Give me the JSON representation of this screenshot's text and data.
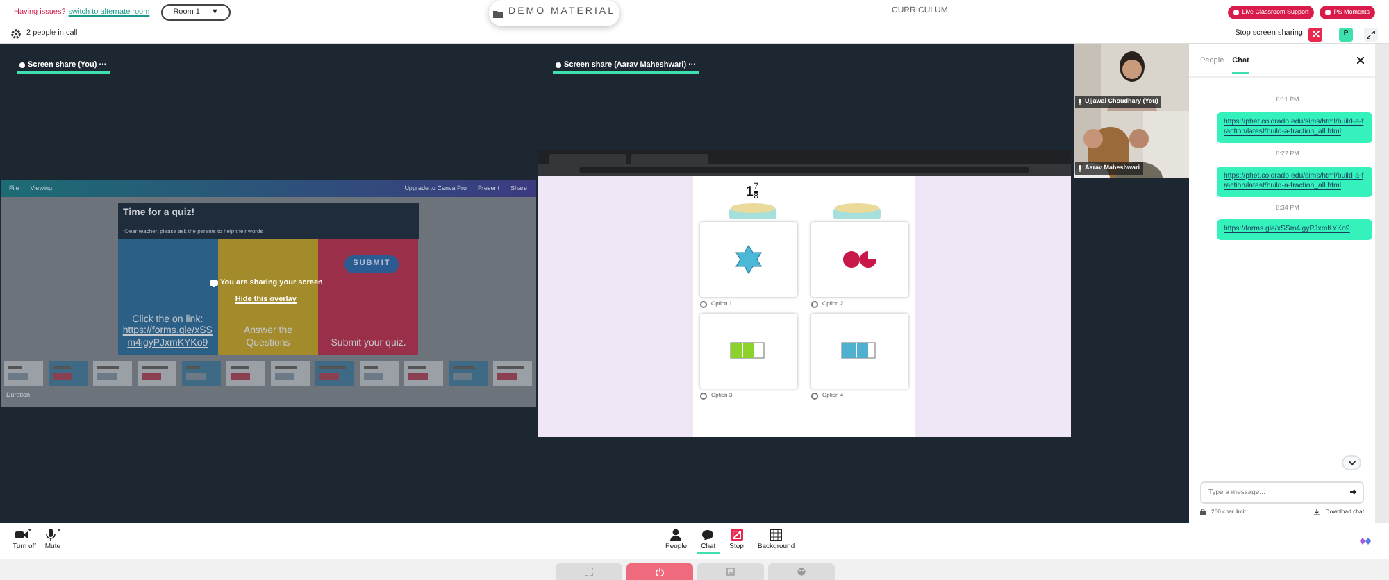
{
  "top_bar": {
    "issue_text": "Having issues?",
    "switch_link": "switch to alternate room",
    "room": "Room 1",
    "room_caret": "▼",
    "center_button": "DEMO MATERIAL",
    "curriculum": "CURRICULUM",
    "buttons": [
      "Live Classroom Support",
      "PS Moments"
    ]
  },
  "call_bar": {
    "people_count": "2 people in call",
    "stop_sharing": "Stop screen sharing",
    "avatar_letter": "P"
  },
  "screens": [
    {
      "title": "Screen share (You)",
      "menu": "···",
      "kind": "canva",
      "toolbar": [
        "File",
        "Viewing",
        "Upgrade to Canva Pro",
        "Present",
        "Share"
      ],
      "slide": {
        "title": "Time for a quiz!",
        "note": "*Dear teacher, please ask the parents to help their words",
        "columns": [
          {
            "text": "Click the on link:",
            "link": "https://forms.gle/xSSm4igyPJxmKYKo9",
            "color": "#2b5f86"
          },
          {
            "text": "Answer the Questions",
            "color": "#a38a2a"
          },
          {
            "text": "Submit your quiz.",
            "button": "SUBMIT",
            "color": "#9a2f4a"
          }
        ]
      },
      "footer": "Duration",
      "overlay": {
        "message": "You are sharing your screen",
        "hide_link": "Hide this overlay"
      }
    },
    {
      "title": "Screen share (Aarav Maheshwari)",
      "menu": "···",
      "kind": "browser",
      "fraction": {
        "whole": "1",
        "numerator": "7",
        "denominator": "8"
      },
      "options": [
        {
          "label": "Option 1",
          "kind": "star",
          "selected": false
        },
        {
          "label": "Option 2",
          "kind": "circles",
          "selected": false
        },
        {
          "label": "Option 3",
          "kind": "green-bars",
          "selected": false
        },
        {
          "label": "Option 4",
          "kind": "blue-bars",
          "selected": false
        }
      ]
    }
  ],
  "videos": [
    {
      "name": "Ujjawal Choudhary (You)",
      "kind": "single"
    },
    {
      "name": "Aarav Maheshwari",
      "kind": "pair"
    }
  ],
  "chat": {
    "tabs": [
      {
        "label": "People",
        "selected": false
      },
      {
        "label": "Chat",
        "selected": true
      }
    ],
    "messages": [
      {
        "time": "8:11 PM",
        "text": "https://phet.colorado.edu/sims/html/build-a-fraction/latest/build-a-fraction_all.html"
      },
      {
        "time": "8:27 PM",
        "text": "https://phet.colorado.edu/sims/html/build-a-fraction/latest/build-a-fraction_all.html"
      },
      {
        "time": "8:34 PM",
        "text": "https://forms.gle/xSSm4igyPJxmKYKo9"
      }
    ],
    "placeholder": "Type a message...",
    "char_limit": "250 char limit",
    "download": "Download chat"
  },
  "controls_left": [
    {
      "label": "Turn off",
      "kind": "camera"
    },
    {
      "label": "Mute",
      "kind": "mic"
    }
  ],
  "controls_center": [
    {
      "label": "People",
      "kind": "people",
      "selected": false
    },
    {
      "label": "Chat",
      "kind": "chat",
      "selected": true
    },
    {
      "label": "Stop",
      "kind": "stop",
      "selected": false
    },
    {
      "label": "Background",
      "kind": "background",
      "selected": false
    }
  ],
  "dock": [
    {
      "kind": "fullscreen"
    },
    {
      "kind": "power"
    },
    {
      "kind": "whiteboard"
    },
    {
      "kind": "palette"
    }
  ]
}
